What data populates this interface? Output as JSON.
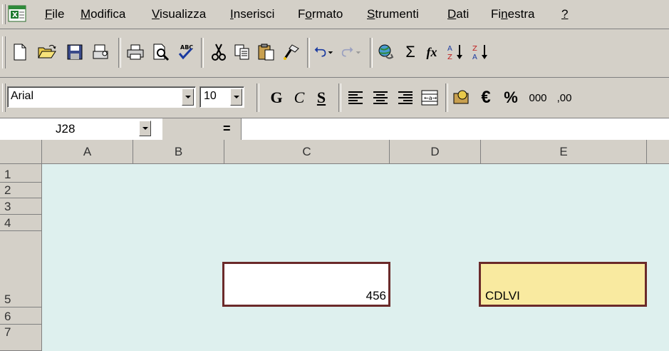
{
  "menubar": {
    "items": [
      {
        "label": "File",
        "mnemonic": "F",
        "rest": "ile"
      },
      {
        "label": "Modifica",
        "mnemonic": "M",
        "rest": "odifica"
      },
      {
        "label": "Visualizza",
        "mnemonic": "V",
        "rest": "isualizza"
      },
      {
        "label": "Inserisci",
        "mnemonic": "I",
        "rest": "nserisci"
      },
      {
        "label": "Formato",
        "pre": "F",
        "mnemonic": "o",
        "rest": "rmato"
      },
      {
        "label": "Strumenti",
        "mnemonic": "S",
        "rest": "trumenti"
      },
      {
        "label": "Dati",
        "mnemonic": "D",
        "rest": "ati"
      },
      {
        "label": "Finestra",
        "pre": "Fi",
        "mnemonic": "n",
        "rest": "estra"
      },
      {
        "label": "?",
        "mnemonic": "?",
        "rest": ""
      }
    ]
  },
  "standard_toolbar": {
    "icons": [
      "new-icon",
      "open-icon",
      "save-icon",
      "permissions-icon",
      "print-icon",
      "print-preview-icon",
      "spelling-icon",
      "cut-icon",
      "copy-icon",
      "paste-icon",
      "format-painter-icon",
      "undo-icon",
      "redo-icon",
      "hyperlink-icon",
      "autosum-icon",
      "function-icon",
      "sort-ascending-icon",
      "sort-descending-icon"
    ],
    "autosum_glyph": "Σ",
    "function_glyph": "fx"
  },
  "format_toolbar": {
    "font_name": "Arial",
    "font_size": "10",
    "bold_label": "G",
    "italic_label": "C",
    "underline_label": "S",
    "currency_label": "€",
    "percent_label": "%",
    "thousands_label": "000",
    "increase_decimal_label": ",00"
  },
  "formula_bar": {
    "cell_reference": "J28",
    "equals_label": "=",
    "formula": ""
  },
  "grid": {
    "columns": [
      "A",
      "B",
      "C",
      "D",
      "E"
    ],
    "rows": [
      "1",
      "2",
      "3",
      "4",
      "5",
      "6",
      "7"
    ],
    "cells": {
      "C5": "456",
      "E5": "CDLVI"
    },
    "colors": {
      "background": "#def0ee",
      "c5_fill": "#ffffff",
      "e5_fill": "#f9eaa0",
      "border": "#6b2a2a"
    }
  }
}
